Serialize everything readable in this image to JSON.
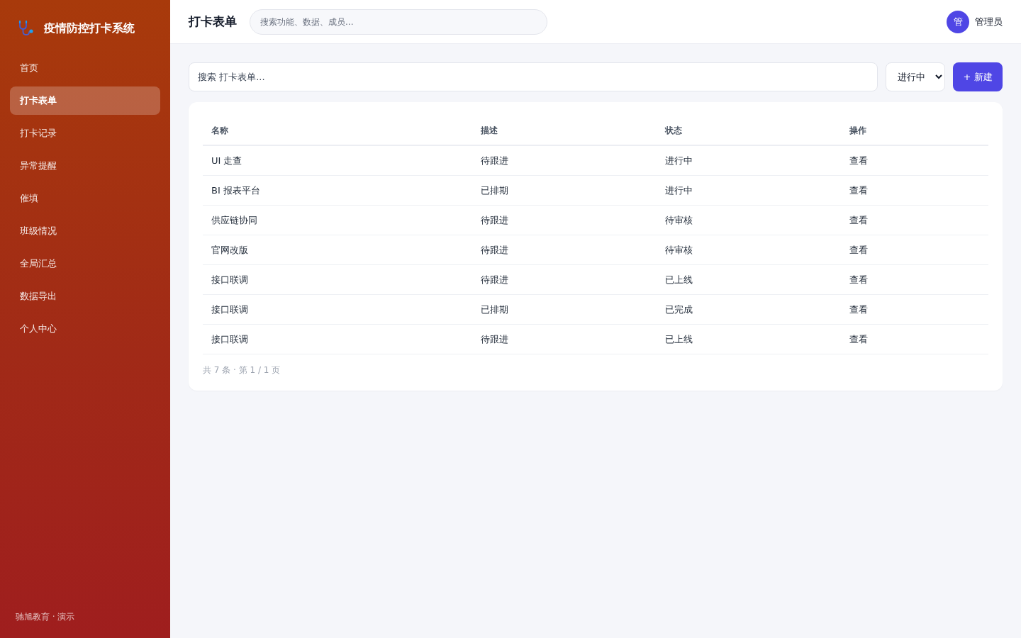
{
  "sidebar": {
    "brand": "疫情防控打卡系统",
    "items": [
      {
        "label": "首页",
        "selected": false
      },
      {
        "label": "打卡表单",
        "selected": true
      },
      {
        "label": "打卡记录",
        "selected": false
      },
      {
        "label": "异常提醒",
        "selected": false
      },
      {
        "label": "催填",
        "selected": false
      },
      {
        "label": "班级情况",
        "selected": false
      },
      {
        "label": "全局汇总",
        "selected": false
      },
      {
        "label": "数据导出",
        "selected": false
      },
      {
        "label": "个人中心",
        "selected": false
      }
    ],
    "footer": "驰旭教育 · 演示"
  },
  "header": {
    "title": "打卡表单",
    "search": {
      "placeholder": "搜索功能、数据、成员..."
    },
    "user": {
      "avatar": "管",
      "name": "管理员"
    }
  },
  "toolbar": {
    "search": {
      "placeholder": "搜索 打卡表单..."
    },
    "filter": {
      "value": "进行中"
    },
    "new_button": "+ 新建"
  },
  "table": {
    "columns": [
      "名称",
      "描述",
      "状态",
      "操作"
    ],
    "rows": [
      {
        "cells": [
          "UI 走查",
          "待跟进",
          "进行中"
        ],
        "action": "查看"
      },
      {
        "cells": [
          "BI 报表平台",
          "已排期",
          "进行中"
        ],
        "action": "查看"
      },
      {
        "cells": [
          "供应链协同",
          "待跟进",
          "待审核"
        ],
        "action": "查看"
      },
      {
        "cells": [
          "官网改版",
          "待跟进",
          "待审核"
        ],
        "action": "查看"
      },
      {
        "cells": [
          "接口联调",
          "待跟进",
          "已上线"
        ],
        "action": "查看"
      },
      {
        "cells": [
          "接口联调",
          "已排期",
          "已完成"
        ],
        "action": "查看"
      },
      {
        "cells": [
          "接口联调",
          "待跟进",
          "已上线"
        ],
        "action": "查看"
      }
    ],
    "pagination": "共 7 条 · 第 1 / 1 页"
  }
}
